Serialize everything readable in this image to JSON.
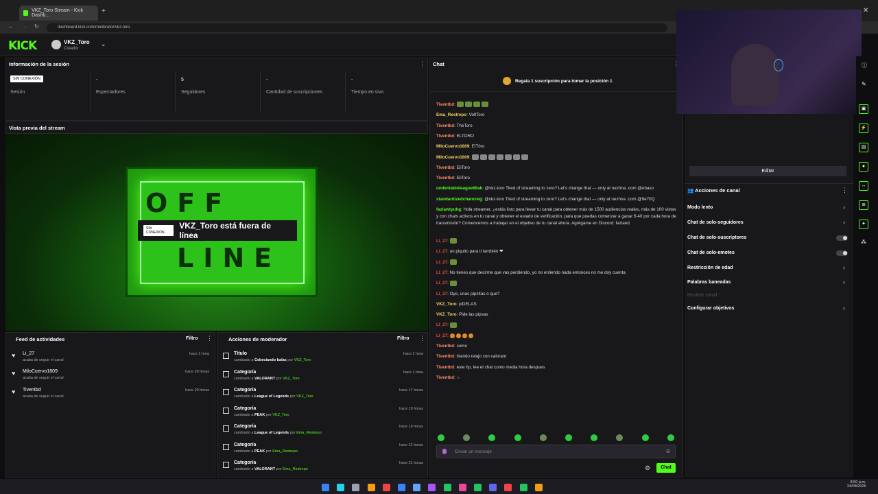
{
  "browser": {
    "tab_title": "VKZ_Toro Stream - Kick Dashb...",
    "url": "dashboard.kick.com/moderator/vkz-toro"
  },
  "header": {
    "logo": "KICK",
    "username": "VKZ_Toro",
    "role": "Creador"
  },
  "session": {
    "title": "Información de la sesión",
    "status_badge": "SIN CONEXIÓN",
    "status_label": "Sesión",
    "stats": [
      {
        "value": "-",
        "label": "Espectadores"
      },
      {
        "value": "5",
        "label": "Seguidores"
      },
      {
        "value": "-",
        "label": "Cantidad de suscripciones"
      },
      {
        "value": "-",
        "label": "Tiempo en vivo"
      }
    ]
  },
  "preview": {
    "title": "Vista previa del stream",
    "badge": "SIN CONEXIÓN",
    "offline_text": "VKZ_Toro está fuera de línea",
    "sign_top": "OFF",
    "sign_bottom": "LINE"
  },
  "activity": {
    "title": "Feed de actividades",
    "filter": "Filtro",
    "items": [
      {
        "name": "Li_27",
        "sub": "acaba de seguir el canal",
        "time": "hace 1 hora"
      },
      {
        "name": "MiloCuervo1809",
        "sub": "acaba de seguir el canal",
        "time": "hace 20 horas"
      },
      {
        "name": "Tiventbd",
        "sub": "acaba de seguir el canal",
        "time": "hace 20 horas"
      }
    ]
  },
  "mod_actions": {
    "title": "Acciones de moderador",
    "filter": "Filtro",
    "por": "por",
    "changed": "cambiado a",
    "items": [
      {
        "name": "Título",
        "value": "Cebeciando balas",
        "by": "VKZ_Toro",
        "time": "hace 1 hora"
      },
      {
        "name": "Categoría",
        "value": "VALORANT",
        "by": "VKZ_Toro",
        "time": "hace 1 hora"
      },
      {
        "name": "Categoría",
        "value": "League of Legends",
        "by": "VKZ_Toro",
        "time": "hace 17 horas"
      },
      {
        "name": "Categoría",
        "value": "PEAK",
        "by": "VKZ_Toro",
        "time": "hace 19 horas"
      },
      {
        "name": "Categoría",
        "value": "League of Legends",
        "by": "Ema_Restrepo",
        "time": "hace 19 horas"
      },
      {
        "name": "Categoría",
        "value": "PEAK",
        "by": "Ema_Restrepo",
        "time": "hace 21 horas"
      },
      {
        "name": "Categoría",
        "value": "VALORANT",
        "by": "Ema_Restrepo",
        "time": "hace 21 horas"
      }
    ]
  },
  "chat": {
    "title": "Chat",
    "gift_banner": "Regala 1 suscripción para tomar la posición 1",
    "input_placeholder": "Enviar un mensaje",
    "send_label": "Chat",
    "messages": [
      {
        "user": "Tiventbd",
        "color": "#ff8a65",
        "text": "",
        "emotes": 4
      },
      {
        "user": "Ema_Restrepo",
        "color": "#f5d061",
        "text": "VoltToro",
        "emotes": 0
      },
      {
        "user": "Tiventbd",
        "color": "#ff8a65",
        "text": "TheToro",
        "emotes": 0
      },
      {
        "user": "Tiventbd",
        "color": "#ff8a65",
        "text": "ELTORO",
        "emotes": 0
      },
      {
        "user": "MiloCuervo1809",
        "color": "#f5d061",
        "text": "ElTöro",
        "emotes": 0
      },
      {
        "user": "MiloCuervo1809",
        "color": "#f5d061",
        "text": "",
        "emotes": 7
      },
      {
        "user": "Tiventbd",
        "color": "#ff8a65",
        "text": "EliToro",
        "emotes": 0
      },
      {
        "user": "Tiventbd",
        "color": "#ff8a65",
        "text": "EliToro",
        "emotes": 0
      },
      {
        "user": "undeniableleague68ak",
        "color": "#53fc18",
        "text": "@vkz-toro Tired of streaming to zero? Let's change that — only at nezhna .com @ehaso",
        "emotes": 0
      },
      {
        "user": "standardizedchancreg",
        "color": "#53fc18",
        "text": "@vkz-toro Tired of streaming to zero? Let's change that — only at nezhna .com @9e70Q",
        "emotes": 0
      },
      {
        "user": "fazlawtyuhg",
        "color": "#53fc18",
        "text": "Hola streamer, ¿estás listo para llevar tu canal para obtener más de 1500 audiencias reales, más de 100 vistas y con chats activos en tu canal y obtener el estado de verificación, para que puedas comenzar a ganar $ 40 por cada hora de transmisión? Comencemos a trabajar en el objetivo de tu canal ahora. Agrégame en Discord: fazlaw1",
        "emotes": 0
      },
      {
        "user": "LI_27",
        "color": "#e74c3c",
        "text": "",
        "emotes": 1
      },
      {
        "user": "LI_27",
        "color": "#e74c3c",
        "text": "un piquito para ti también ❤",
        "emotes": 0
      },
      {
        "user": "LI_27",
        "color": "#e74c3c",
        "text": "",
        "emotes": 1
      },
      {
        "user": "LI_27",
        "color": "#e74c3c",
        "text": "No tienes que decirme que vas perdiendo, yo no entiendo nada entonces no me doy cuenta",
        "emotes": 0
      },
      {
        "user": "LI_27",
        "color": "#e74c3c",
        "text": "",
        "emotes": 1
      },
      {
        "user": "LI_27",
        "color": "#e74c3c",
        "text": "Oye, unas pipzitas o que?",
        "emotes": 0
      },
      {
        "user": "VKZ_Toro",
        "color": "#f5d061",
        "text": "piDELAS",
        "emotes": 0
      },
      {
        "user": "VKZ_Toro",
        "color": "#f5d061",
        "text": "Pide las pipsas",
        "emotes": 0
      },
      {
        "user": "LI_27",
        "color": "#e74c3c",
        "text": "",
        "emotes": 1
      },
      {
        "user": "LI_27",
        "color": "#e74c3c",
        "text": "",
        "emotes": 4
      },
      {
        "user": "Tiventbd",
        "color": "#ff8a65",
        "text": "como",
        "emotes": 0
      },
      {
        "user": "Tiventbd",
        "color": "#ff8a65",
        "text": "tirando relajo con valorant",
        "emotes": 0
      },
      {
        "user": "Tiventbd",
        "color": "#ff8a65",
        "text": "este hp, lee el chat como media hora despues",
        "emotes": 0
      },
      {
        "user": "Tiventbd",
        "color": "#ff8a65",
        "text": ":-.",
        "emotes": 0
      }
    ]
  },
  "channel_actions": {
    "edit_label": "Editar",
    "title": "Acciones de canal",
    "items": [
      {
        "label": "Modo lento",
        "control": "chevron"
      },
      {
        "label": "Chat de solo-seguidores",
        "control": "chevron"
      },
      {
        "label": "Chat de solo-suscriptores",
        "control": "toggle"
      },
      {
        "label": "Chat de solo-emotes",
        "control": "toggle"
      },
      {
        "label": "Restricción de edad",
        "control": "chevron"
      },
      {
        "label": "Palabras baneadas",
        "control": "chevron"
      },
      {
        "label": "Hostear canal",
        "control": "disabled"
      },
      {
        "label": "Configurar objetivos",
        "control": "chevron"
      }
    ]
  },
  "taskbar": {
    "time": "8:50 p.m.",
    "date": "24/08/2025"
  }
}
